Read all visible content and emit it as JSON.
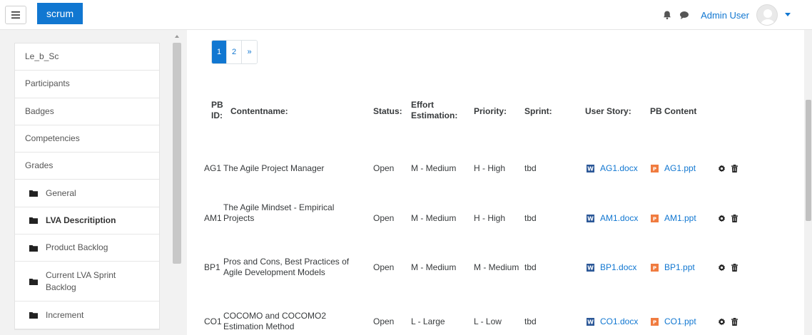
{
  "navbar": {
    "brand": "scrum",
    "user_name": "Admin User"
  },
  "drawer": {
    "items": [
      {
        "label": "Le_b_Sc"
      },
      {
        "label": "Participants"
      },
      {
        "label": "Badges"
      },
      {
        "label": "Competencies"
      },
      {
        "label": "Grades"
      },
      {
        "label": "General"
      },
      {
        "label": "LVA Descritiption"
      },
      {
        "label": "Product Backlog"
      },
      {
        "label": "Current LVA Sprint Backlog"
      },
      {
        "label": "Increment"
      }
    ]
  },
  "pagination": {
    "pages": [
      "1",
      "2",
      "»"
    ],
    "active": "1"
  },
  "table": {
    "headers": {
      "pbid": "PB ID:",
      "contentname": "Contentname:",
      "status": "Status:",
      "effort": "Effort Estimation:",
      "priority": "Priority:",
      "sprint": "Sprint:",
      "userstory": "User Story:",
      "pbcontent": "PB Content"
    },
    "rows": [
      {
        "id": "AG1",
        "name": "The Agile Project Manager",
        "status": "Open",
        "effort": "M - Medium",
        "priority": "H - High",
        "sprint": "tbd",
        "doc": "AG1.docx",
        "ppt": "AG1.ppt"
      },
      {
        "id": "AM1",
        "name": "The Agile Mindset - Empirical Projects",
        "status": "Open",
        "effort": "M - Medium",
        "priority": "H - High",
        "sprint": "tbd",
        "doc": "AM1.docx",
        "ppt": "AM1.ppt"
      },
      {
        "id": "BP1",
        "name": "Pros and Cons, Best Practices of Agile Development Models",
        "status": "Open",
        "effort": "M - Medium",
        "priority": "M - Medium",
        "sprint": "tbd",
        "doc": "BP1.docx",
        "ppt": "BP1.ppt"
      },
      {
        "id": "CO1",
        "name": "COCOMO and COCOMO2 Estimation Method",
        "status": "Open",
        "effort": "L - Large",
        "priority": "L - Low",
        "sprint": "tbd",
        "doc": "CO1.docx",
        "ppt": "CO1.ppt"
      }
    ]
  },
  "colors": {
    "brand": "#1177d1",
    "word_icon": "#2b5797",
    "ppt_icon": "#f07b3f"
  }
}
